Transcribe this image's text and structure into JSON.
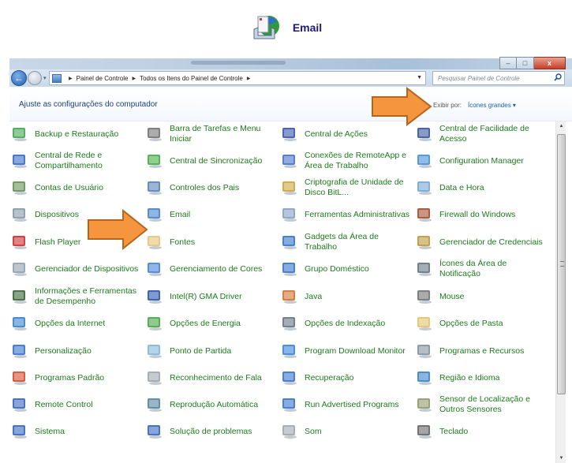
{
  "heading": {
    "title": "Email",
    "icon": "email-icon"
  },
  "window": {
    "title_blurred": "",
    "buttons": {
      "minimize": "–",
      "maximize": "□",
      "close": "x"
    },
    "nav": {
      "back": "←",
      "dropdown": "▾"
    },
    "breadcrumb": [
      "Painel de Controle",
      "Todos os Itens do Painel de Controle"
    ],
    "search_placeholder": "Pesquisar Painel de Controle",
    "refresh": "↻"
  },
  "toolbar": {
    "heading": "Ajuste as configurações do computador",
    "view_label": "Exibir por:",
    "view_value": "Ícones grandes ▾"
  },
  "scrollbar": {
    "up": "▲",
    "down": "▼"
  },
  "colors": {
    "link": "#1c7a1c",
    "heading": "#1e3f7a",
    "arrow": "#f5963e",
    "arrow_border": "#b5651d"
  },
  "items": [
    {
      "label": "Backup e Restauração",
      "icon": "backup-icon"
    },
    {
      "label": "Barra de Tarefas e Menu Iniciar",
      "icon": "taskbar-icon"
    },
    {
      "label": "Central de Ações",
      "icon": "flag-icon"
    },
    {
      "label": "Central de Facilidade de Acesso",
      "icon": "accessibility-icon"
    },
    {
      "label": "Central de Rede e Compartilhamento",
      "icon": "network-icon"
    },
    {
      "label": "Central de Sincronização",
      "icon": "sync-icon"
    },
    {
      "label": "Conexões de RemoteApp e Área de Trabalho",
      "icon": "remoteapp-icon"
    },
    {
      "label": "Configuration Manager",
      "icon": "config-manager-icon"
    },
    {
      "label": "Contas de Usuário",
      "icon": "users-icon"
    },
    {
      "label": "Controles dos Pais",
      "icon": "parental-icon"
    },
    {
      "label": "Criptografia de Unidade de Disco BitL...",
      "icon": "bitlocker-icon"
    },
    {
      "label": "Data e Hora",
      "icon": "clock-icon"
    },
    {
      "label": "Dispositivos",
      "icon": "devices-icon"
    },
    {
      "label": "Email",
      "icon": "email-icon"
    },
    {
      "label": "Ferramentas Administrativas",
      "icon": "admin-tools-icon"
    },
    {
      "label": "Firewall do Windows",
      "icon": "firewall-icon"
    },
    {
      "label": "Flash Player",
      "icon": "flash-icon"
    },
    {
      "label": "Fontes",
      "icon": "fonts-icon"
    },
    {
      "label": "Gadgets da Área de Trabalho",
      "icon": "gadgets-icon"
    },
    {
      "label": "Gerenciador de Credenciais",
      "icon": "vault-icon"
    },
    {
      "label": "Gerenciador de Dispositivos",
      "icon": "device-manager-icon"
    },
    {
      "label": "Gerenciamento de Cores",
      "icon": "color-icon"
    },
    {
      "label": "Grupo Doméstico",
      "icon": "homegroup-icon"
    },
    {
      "label": "Ícones da Área de Notificação",
      "icon": "notification-icon"
    },
    {
      "label": "Informações e Ferramentas de Desempenho",
      "icon": "performance-icon"
    },
    {
      "label": "Intel(R) GMA Driver",
      "icon": "intel-icon"
    },
    {
      "label": "Java",
      "icon": "java-icon"
    },
    {
      "label": "Mouse",
      "icon": "mouse-icon"
    },
    {
      "label": "Opções da Internet",
      "icon": "internet-options-icon"
    },
    {
      "label": "Opções de Energia",
      "icon": "power-icon"
    },
    {
      "label": "Opções de Indexação",
      "icon": "indexing-icon"
    },
    {
      "label": "Opções de Pasta",
      "icon": "folder-options-icon"
    },
    {
      "label": "Personalização",
      "icon": "personalization-icon"
    },
    {
      "label": "Ponto de Partida",
      "icon": "getting-started-icon"
    },
    {
      "label": "Program Download Monitor",
      "icon": "download-monitor-icon"
    },
    {
      "label": "Programas e Recursos",
      "icon": "programs-icon"
    },
    {
      "label": "Programas Padrão",
      "icon": "default-programs-icon"
    },
    {
      "label": "Reconhecimento de Fala",
      "icon": "microphone-icon"
    },
    {
      "label": "Recuperação",
      "icon": "recovery-icon"
    },
    {
      "label": "Região e Idioma",
      "icon": "region-icon"
    },
    {
      "label": "Remote Control",
      "icon": "remote-control-icon"
    },
    {
      "label": "Reprodução Automática",
      "icon": "autoplay-icon"
    },
    {
      "label": "Run Advertised Programs",
      "icon": "run-programs-icon"
    },
    {
      "label": "Sensor de Localização e Outros Sensores",
      "icon": "sensor-icon"
    },
    {
      "label": "Sistema",
      "icon": "system-icon"
    },
    {
      "label": "Solução de problemas",
      "icon": "troubleshoot-icon"
    },
    {
      "label": "Som",
      "icon": "speaker-icon"
    },
    {
      "label": "Teclado",
      "icon": "keyboard-icon"
    }
  ]
}
